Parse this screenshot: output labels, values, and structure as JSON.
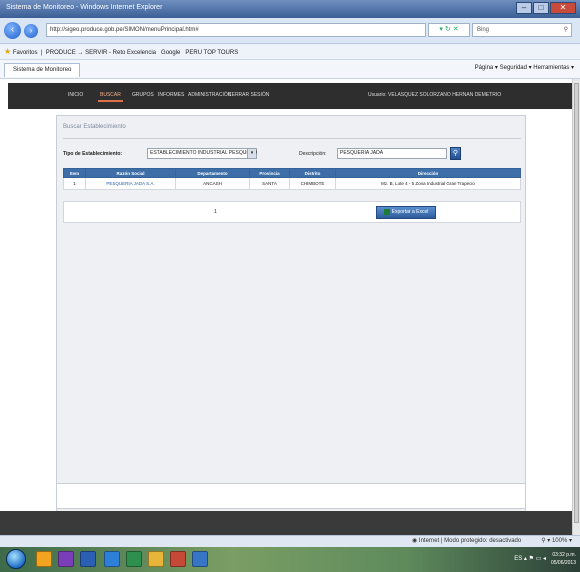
{
  "window": {
    "title": "Sistema de Monitoreo - Windows Internet Explorer"
  },
  "browser": {
    "address": "http://sigeo.produce.gob.pe/SIMON/menuPrincipal.htm#",
    "search_placeholder": "Bing",
    "favorites_label": "Favoritos",
    "favorites_links": [
      "PRODUCE → SERVIR - Reto Excelencia",
      "Google",
      "PERU TOP TOURS"
    ],
    "tab_title": "Sistema de Monitoreo",
    "command_bar": "Página ▾  Seguridad ▾  Herramientas ▾"
  },
  "nav": {
    "items": [
      "INICIO",
      "BUSCAR",
      "GRUPOS",
      "INFORMES",
      "ADMINISTRACIÓN",
      "CERRAR SESIÓN"
    ],
    "user": "Usuario: VELASQUEZ SOLORZANO HERNAN DEMETRIO"
  },
  "search": {
    "section_title": "Buscar Establecimiento",
    "tipo_label": "Tipo de Establecimiento:",
    "tipo_value": "ESTABLECIMIENTO INDUSTRIAL PESQUERO",
    "descripcion_label": "Descripción:",
    "descripcion_value": "PESQUERIA JADA"
  },
  "results": {
    "headers": [
      "Item",
      "Razón Social",
      "Departamento",
      "Provincia",
      "Distrito",
      "Dirección"
    ],
    "rows": [
      [
        "1",
        "PESQUERIA JADA S.A.",
        "ANCASH",
        "SANTA",
        "CHIMBOTE",
        "Mz. B, Lote 4 - 5 Zona Industrial Gran Trapecio"
      ]
    ],
    "page": "1",
    "export_label": "Exportar a Excel"
  },
  "status": {
    "zone": "Internet | Modo protegido: desactivado",
    "zoom": "100%"
  },
  "clock": {
    "time": "03:32 p.m.",
    "date": "05/06/2013"
  },
  "colors": {
    "nav_bg": "#2e2e2e",
    "accent": "#3e6ea8",
    "active_tab": "#e0704a"
  }
}
